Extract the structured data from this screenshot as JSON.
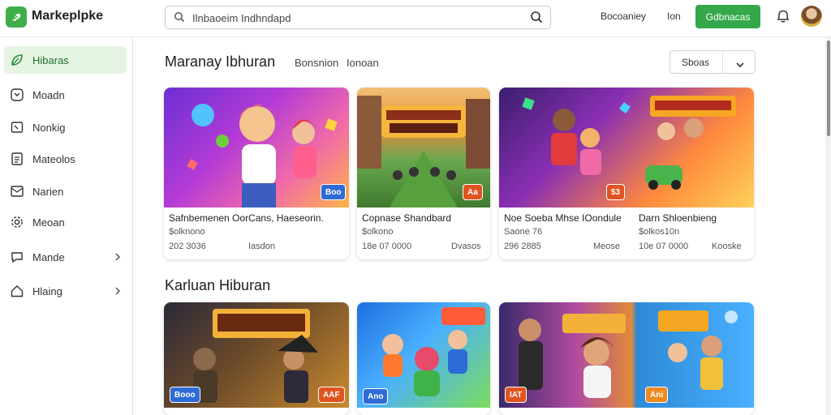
{
  "header": {
    "brand": "Markeplpke",
    "search_value": "Ilnbaoeim Indhndapd",
    "nav_1": "Bocoaniey",
    "nav_2": "Ion",
    "cta_label": "Gdbnacas"
  },
  "sidebar": {
    "items": [
      {
        "label": "Hibaras",
        "icon": "leaf-icon"
      },
      {
        "label": "Moadn",
        "icon": "circle-arrow-icon"
      },
      {
        "label": "Nonkig",
        "icon": "square-arrow-icon"
      },
      {
        "label": "Mateolos",
        "icon": "document-icon"
      },
      {
        "label": "Narien",
        "icon": "inbox-icon"
      },
      {
        "label": "Meoan",
        "icon": "gear-icon"
      },
      {
        "label": "Mande",
        "icon": "chat-icon"
      },
      {
        "label": "Hlaing",
        "icon": "home-icon"
      }
    ]
  },
  "section1": {
    "title": "Maranay Ibhuran",
    "link_1": "Bonsnion",
    "link_2": "Ionoan",
    "sort_label": "Sboas"
  },
  "section2": {
    "title": "Karluan Hiburan"
  },
  "row1_cards": [
    {
      "title": "Safnbemenen OorCans, Haeseorin.",
      "rating": "$olknono",
      "meta_left": "202 3036",
      "meta_right": "Iasdon",
      "badge": "Boo"
    },
    {
      "title": "Copnase Shandbard",
      "rating": "$olkono",
      "meta_left": "18e 07 0000",
      "meta_right": "Dvasos",
      "badge": "Aa"
    },
    {
      "title": "Noe Soeba Mhse IOondule",
      "rating": "Saone 76",
      "meta_left": "296 2885",
      "meta_right": "Meose",
      "badge": "$3"
    },
    {
      "title": "Darn Shloenbieng",
      "rating": "$olkos10n",
      "meta_left": "10e 07 0000",
      "meta_right": "Kooske",
      "badge": ""
    }
  ],
  "row2_badges": [
    "Booo",
    "AAF",
    "Ano",
    "IAT",
    "Ani"
  ],
  "colors": {
    "accent": "#34a84a",
    "active_bg": "#e6f5e3",
    "badge_blue": "#2d6bd6",
    "badge_orange": "#e0541f"
  }
}
